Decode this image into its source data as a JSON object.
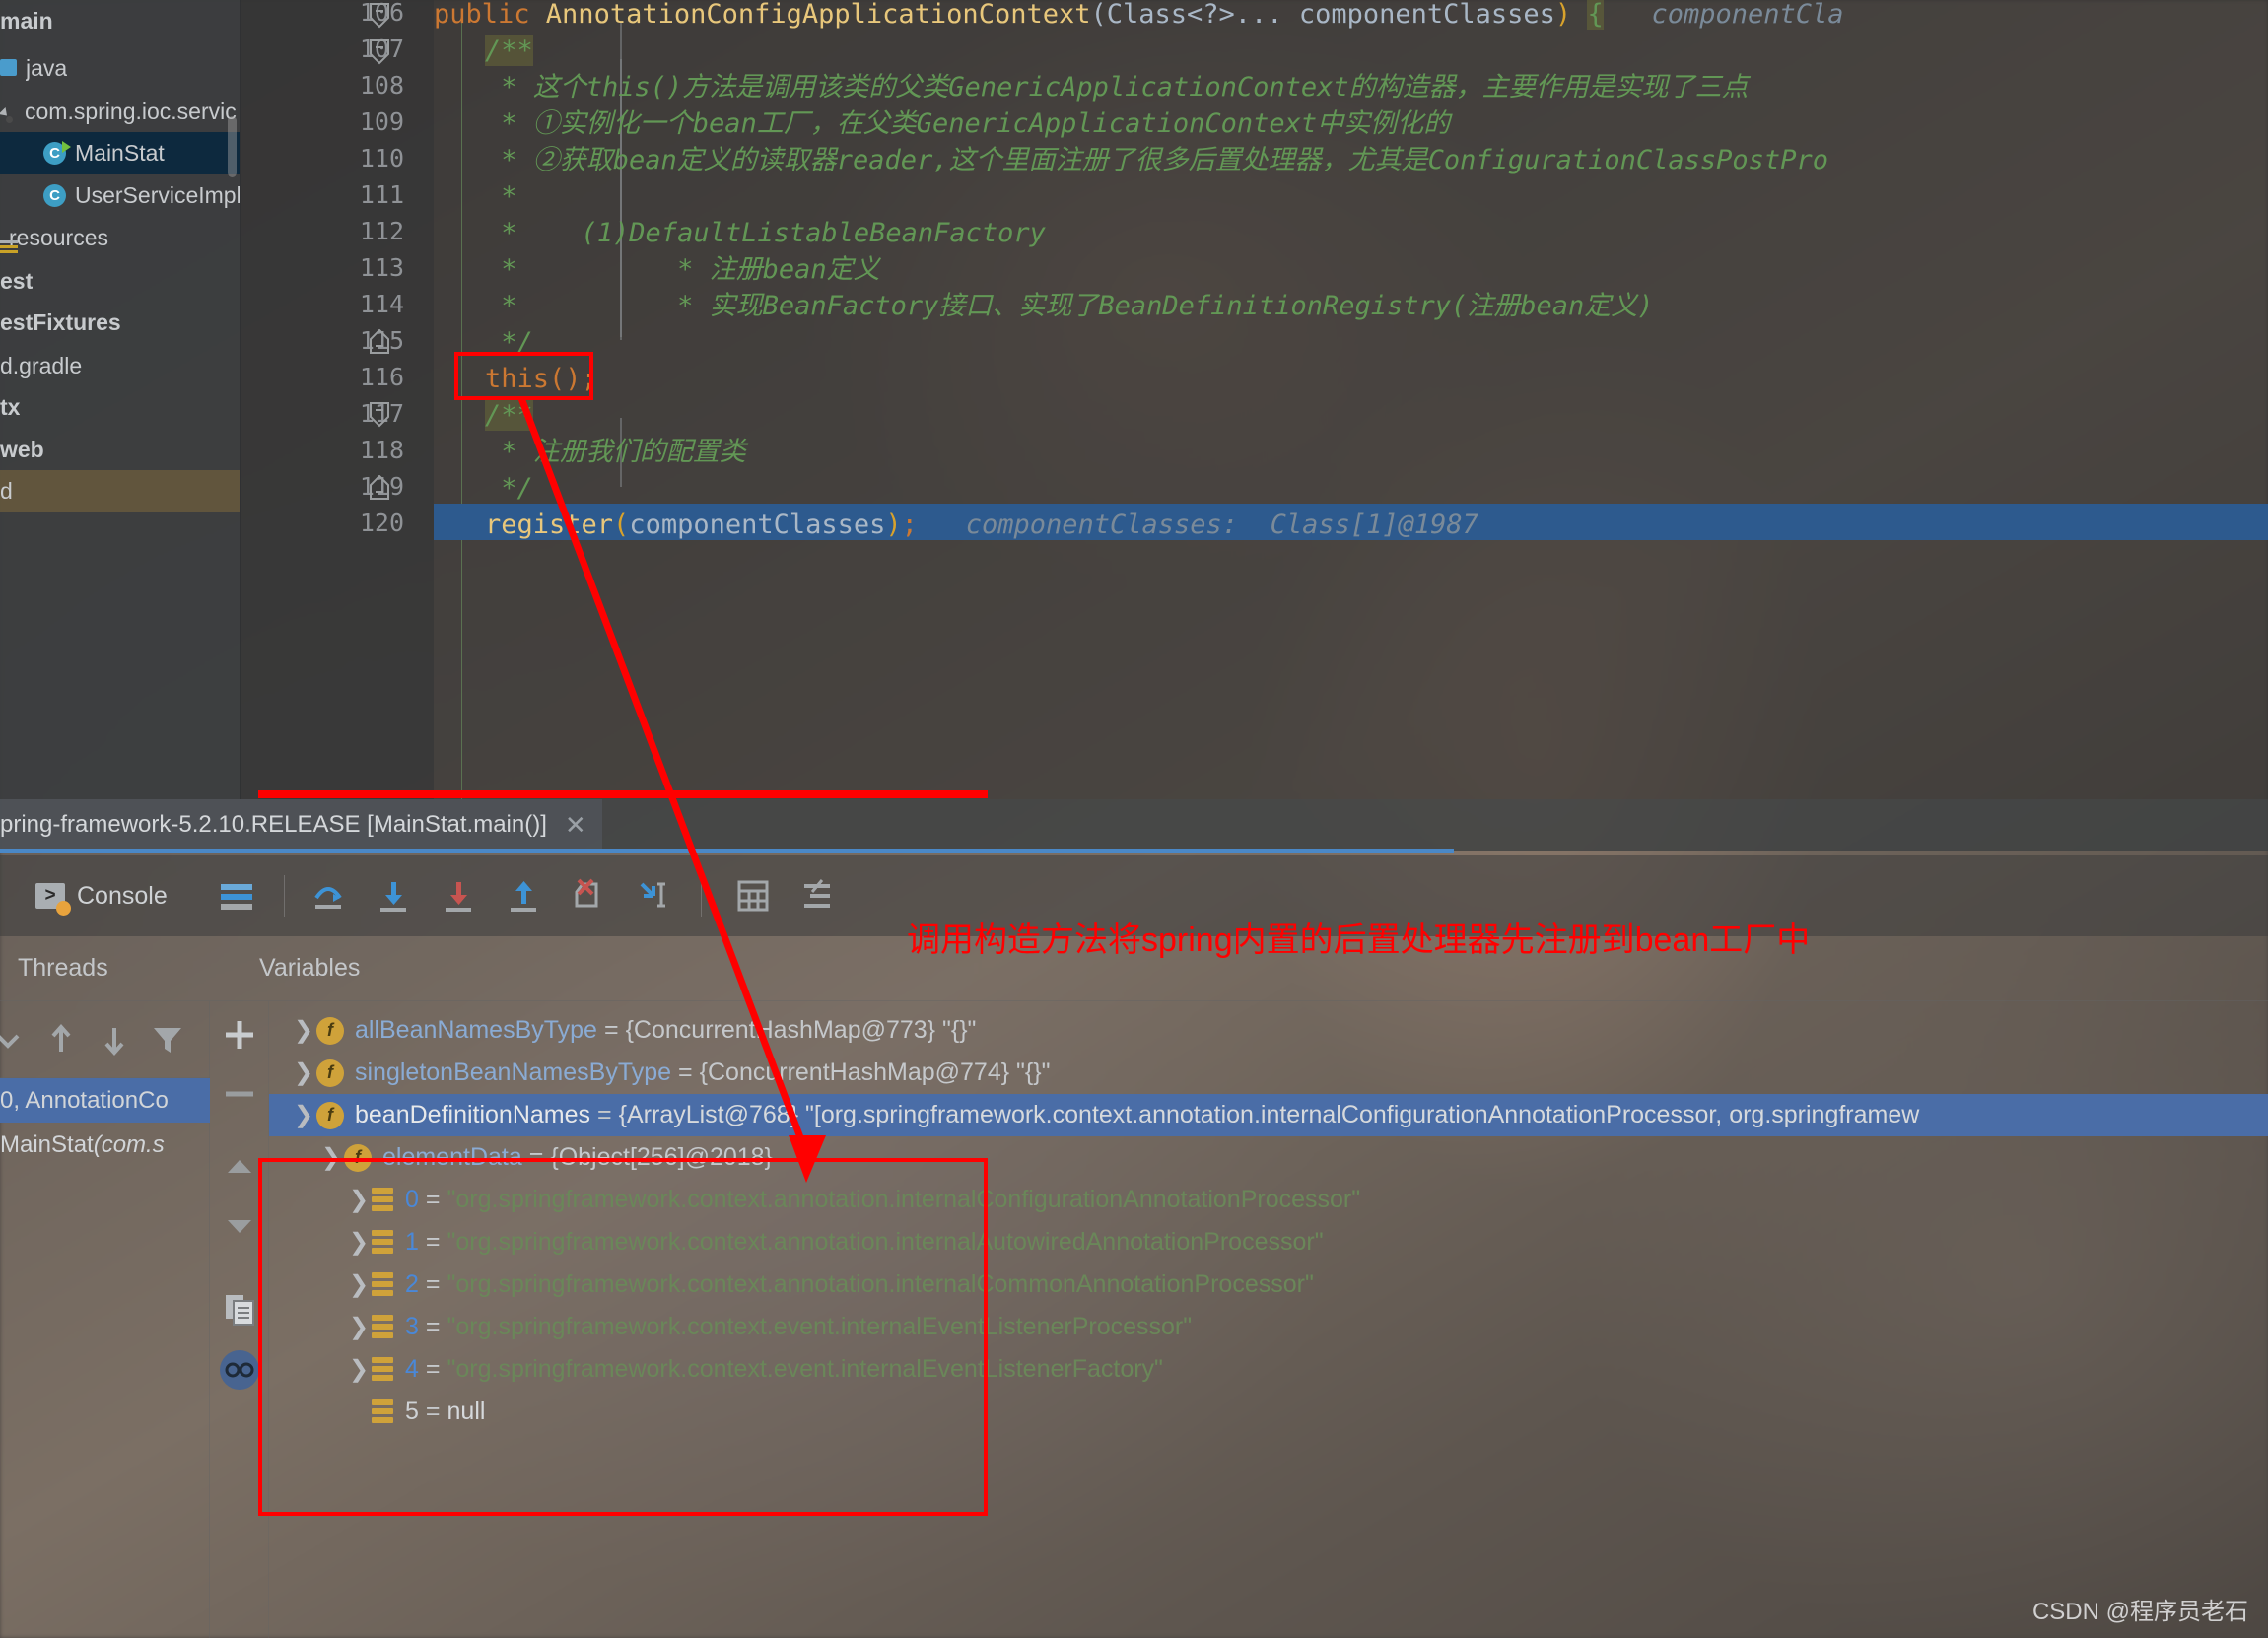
{
  "project_tree": {
    "items": [
      {
        "label": "main",
        "icon": "folder-icon",
        "bold": true,
        "indent": 0,
        "state": "normal"
      },
      {
        "label": "java",
        "icon": "source-folder-icon",
        "bold": false,
        "indent": 8,
        "state": "normal"
      },
      {
        "label": "com.spring.ioc.servic",
        "icon": "package-icon",
        "bold": false,
        "indent": 18,
        "state": "normal"
      },
      {
        "label": "MainStat",
        "icon": "class-runnable-icon",
        "bold": false,
        "indent": 48,
        "state": "selected"
      },
      {
        "label": "UserServiceImpl",
        "icon": "class-icon",
        "bold": false,
        "indent": 48,
        "state": "normal"
      },
      {
        "label": "resources",
        "icon": "resources-folder-icon",
        "bold": false,
        "indent": 0,
        "state": "normal"
      },
      {
        "label": "est",
        "icon": "none",
        "bold": true,
        "indent": 0,
        "state": "normal"
      },
      {
        "label": "estFixtures",
        "icon": "none",
        "bold": true,
        "indent": 0,
        "state": "normal"
      },
      {
        "label": "d.gradle",
        "icon": "none",
        "bold": false,
        "indent": 0,
        "state": "normal"
      },
      {
        "label": "tx",
        "icon": "none",
        "bold": true,
        "indent": 0,
        "state": "normal"
      },
      {
        "label": "web",
        "icon": "none",
        "bold": true,
        "indent": 0,
        "state": "normal"
      },
      {
        "label": "d",
        "icon": "none",
        "bold": false,
        "indent": 0,
        "state": "highlighted"
      }
    ]
  },
  "editor": {
    "line_numbers": [
      "106",
      "107",
      "108",
      "109",
      "110",
      "111",
      "112",
      "113",
      "114",
      "115",
      "116",
      "117",
      "118",
      "119",
      "120"
    ],
    "lines": [
      {
        "num": "106",
        "type": "code",
        "text": "public AnnotationConfigApplicationContext(Class<?>... componentClasses) {",
        "hint": "componentCla"
      },
      {
        "num": "107",
        "type": "comment",
        "text": "/**"
      },
      {
        "num": "108",
        "type": "comment",
        "text": " * 这个this()方法是调用该类的父类GenericApplicationContext的构造器，主要作用是实现了三点"
      },
      {
        "num": "109",
        "type": "comment",
        "text": " * ①实例化一个bean工厂，在父类GenericApplicationContext中实例化的"
      },
      {
        "num": "110",
        "type": "comment",
        "text": " * ②获取bean定义的读取器reader,这个里面注册了很多后置处理器，尤其是ConfigurationClassPostPro"
      },
      {
        "num": "111",
        "type": "comment",
        "text": " *"
      },
      {
        "num": "112",
        "type": "comment",
        "text": " *    (1)DefaultListableBeanFactory"
      },
      {
        "num": "113",
        "type": "comment",
        "text": " *          * 注册bean定义"
      },
      {
        "num": "114",
        "type": "comment",
        "text": " *          * 实现BeanFactory接口、实现了BeanDefinitionRegistry(注册bean定义)"
      },
      {
        "num": "115",
        "type": "comment",
        "text": " */"
      },
      {
        "num": "116",
        "type": "code",
        "text": "this();"
      },
      {
        "num": "117",
        "type": "comment",
        "text": "/**"
      },
      {
        "num": "118",
        "type": "comment",
        "text": " * 注册我们的配置类"
      },
      {
        "num": "119",
        "type": "comment",
        "text": " */"
      },
      {
        "num": "120",
        "type": "code",
        "text": "register(componentClasses);",
        "hint": "componentClasses:  Class[1]@1987",
        "current": true,
        "breakpoint": true
      }
    ],
    "code_106": {
      "kw_public": "public",
      "method_name": "AnnotationConfigApplicationContext",
      "params": "(Class<?>... componentClasses)",
      "brace": "{",
      "hint": "componentCla"
    },
    "code_116": "this();",
    "code_120": {
      "call": "register",
      "args": "(componentClasses)",
      "semi": ";",
      "hint": "componentClasses:  Class[1]@1987"
    }
  },
  "run_panel": {
    "tab_label": "pring-framework-5.2.10.RELEASE [MainStat.main()]",
    "tab_close": "✕",
    "console_label": "Console",
    "toolbar_icons": [
      "layout-icon",
      "step-over-icon",
      "step-into-icon",
      "force-step-into-icon",
      "step-out-icon",
      "drop-frame-icon",
      "run-to-cursor-icon",
      "evaluate-expression-icon",
      "settings-icon"
    ]
  },
  "threads": {
    "title": "Threads",
    "toolbar_icons": [
      "collapse-icon",
      "up-arrow-icon",
      "down-arrow-icon",
      "filter-icon"
    ],
    "rows": [
      {
        "label": "0, AnnotationCo",
        "italic": "",
        "selected": true
      },
      {
        "label": "MainStat ",
        "italic": "(com.s",
        "selected": false
      }
    ]
  },
  "variables": {
    "title": "Variables",
    "toolbar_icons": [
      "plus-icon",
      "minus-icon",
      "up-triangle-icon",
      "down-triangle-icon",
      "copy-icon",
      "watch-icon"
    ],
    "rows": [
      {
        "indent": 0,
        "chevron": "right",
        "icon": "field-icon",
        "name": "allBeanNamesByType",
        "name_style": "blue",
        "value": "{ConcurrentHashMap@773} \"{}\"",
        "value_style": "plain",
        "selected": false
      },
      {
        "indent": 0,
        "chevron": "right",
        "icon": "field-icon",
        "name": "singletonBeanNamesByType",
        "name_style": "blue",
        "value": "{ConcurrentHashMap@774} \"{}\"",
        "value_style": "plain",
        "selected": false
      },
      {
        "indent": 0,
        "chevron": "down",
        "icon": "field-icon",
        "name": "beanDefinitionNames",
        "name_style": "white",
        "value": "{ArrayList@768} \"[org.springframework.context.annotation.internalConfigurationAnnotationProcessor, org.springframew",
        "value_style": "white",
        "selected": true
      },
      {
        "indent": 1,
        "chevron": "down",
        "icon": "field-icon",
        "name": "elementData",
        "name_style": "blue",
        "value": "{Object[256]@2018}",
        "value_style": "plain",
        "selected": false
      },
      {
        "indent": 2,
        "chevron": "right",
        "icon": "array-icon",
        "name": "0",
        "name_style": "index",
        "value": "\"org.springframework.context.annotation.internalConfigurationAnnotationProcessor\"",
        "value_style": "string",
        "selected": false
      },
      {
        "indent": 2,
        "chevron": "right",
        "icon": "array-icon",
        "name": "1",
        "name_style": "index",
        "value": "\"org.springframework.context.annotation.internalAutowiredAnnotationProcessor\"",
        "value_style": "string",
        "selected": false
      },
      {
        "indent": 2,
        "chevron": "right",
        "icon": "array-icon",
        "name": "2",
        "name_style": "index",
        "value": "\"org.springframework.context.annotation.internalCommonAnnotationProcessor\"",
        "value_style": "string",
        "selected": false
      },
      {
        "indent": 2,
        "chevron": "right",
        "icon": "array-icon",
        "name": "3",
        "name_style": "index",
        "value": "\"org.springframework.context.event.internalEventListenerProcessor\"",
        "value_style": "string",
        "selected": false
      },
      {
        "indent": 2,
        "chevron": "right",
        "icon": "array-icon",
        "name": "4",
        "name_style": "index",
        "value": "\"org.springframework.context.event.internalEventListenerFactory\"",
        "value_style": "string",
        "selected": false
      },
      {
        "indent": 2,
        "chevron": "none",
        "icon": "array-icon",
        "name": "5",
        "name_style": "index-white",
        "value": "null",
        "value_style": "white",
        "selected": false
      }
    ]
  },
  "annotations": {
    "red_note": "调用构造方法将spring内置的后置处理器先注册到bean工厂中",
    "accent_red": "#ff0000"
  },
  "watermark": "CSDN @程序员老石"
}
